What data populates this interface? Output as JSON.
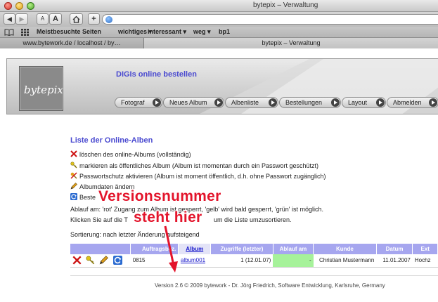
{
  "browser": {
    "window_title": "bytepix – Verwaltung",
    "nav_back": "◀",
    "nav_forward": "▶",
    "text_smaller": "A",
    "text_larger": "A",
    "home_icon": "home-icon",
    "add_bookmark": "+",
    "bookmarks": [
      "Meistbesuchte Seiten",
      "wichtiges ▾",
      "interessant ▾",
      "weg ▾",
      "bp1"
    ],
    "tabs": [
      "www.bytework.de / localhost / by…",
      "bytepix – Verwaltung"
    ]
  },
  "header": {
    "logo_text": "bytepix",
    "heading": "DIGIs online bestellen",
    "nav": [
      "Fotograf",
      "Neues Album",
      "Albenliste",
      "Bestellungen",
      "Layout",
      "Abmelden"
    ]
  },
  "main": {
    "title": "Liste der Online-Alben",
    "legend": [
      {
        "icon": "delete-x-icon",
        "text": "löschen des online-Albums (vollständig)"
      },
      {
        "icon": "key-yellow-icon",
        "text": "markieren als öffentliches Album (Album ist momentan durch ein Passwort geschützt)"
      },
      {
        "icon": "key-crossed-icon",
        "text": "Passwortschutz aktivieren (Album ist moment öffentlich, d.h. ohne Passwort zugänglich)"
      },
      {
        "icon": "pencil-icon",
        "text": "Albumdaten ändern"
      },
      {
        "icon": "refresh-icon",
        "text": "Beste"
      }
    ],
    "ablauf_note": "Ablauf am: 'rot' Zugang zum Album ist gesperrt, 'gelb' wird bald gesperrt, 'grün' ist möglich.",
    "sort_hint_start": "Klicken Sie auf die T",
    "sort_hint_end": "um die Liste umzusortieren.",
    "sort_state": "Sortierung: nach letzter Änderung aufsteigend",
    "table": {
      "headers": [
        "Auftragsbez.",
        "Album",
        "Zugriffe (letzter)",
        "Ablauf am",
        "Kunde",
        "Datum",
        "Ext"
      ],
      "rows": [
        {
          "auftrag": "0815",
          "album": "album001",
          "zugriffe": "1 (12.01.07)",
          "ablauf": "-",
          "kunde": "Christian Mustermann",
          "datum": "11.01.2007",
          "ext": "Hochz"
        }
      ]
    },
    "footer": "Version 2.6 © 2009 bytework - Dr. Jörg Friedrich, Software Entwicklung, Karlsruhe, Germany"
  },
  "annotation": {
    "line1": "Versionsnummer",
    "line2": "steht hier",
    "color": "#e3142b"
  }
}
